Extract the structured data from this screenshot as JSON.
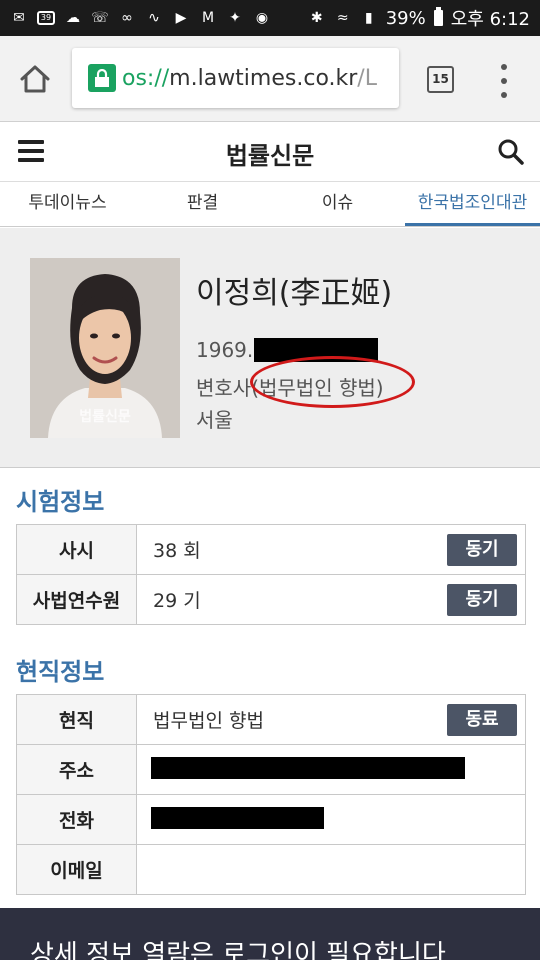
{
  "status_bar": {
    "battery_percent": "39%",
    "time": "오후 6:12",
    "left_icons": [
      "message-icon",
      "calendar-icon",
      "cloud-icon",
      "phone-icon",
      "link-icon",
      "vibrate-icon",
      "play-icon",
      "mail-icon",
      "twitter-icon",
      "instagram-icon"
    ],
    "right_icons": [
      "bluetooth-icon",
      "wifi-icon",
      "signal-icon",
      "battery-icon"
    ]
  },
  "browser": {
    "url_scheme": "os://",
    "url_host": "m.lawtimes.co.kr",
    "url_rest": "/L",
    "tab_count": "15"
  },
  "site": {
    "title": "법률신문"
  },
  "nav_tabs": [
    "투데이뉴스",
    "판결",
    "이슈",
    "한국법조인대관"
  ],
  "nav_active_index": 3,
  "profile": {
    "name": "이정희(李正姬)",
    "birth_prefix": "1969.",
    "job": "변호사(법무법인 향법)",
    "location": "서울",
    "photo_watermark": "법률신문"
  },
  "exam_section": {
    "title": "시험정보",
    "rows": [
      {
        "label": "사시",
        "value": "38 회",
        "button": "동기"
      },
      {
        "label": "사법연수원",
        "value": "29 기",
        "button": "동기"
      }
    ]
  },
  "job_section": {
    "title": "현직정보",
    "rows": [
      {
        "label": "현직",
        "value": "법무법인 향법",
        "button": "동료"
      },
      {
        "label": "주소",
        "value": ""
      },
      {
        "label": "전화",
        "value": ""
      },
      {
        "label": "이메일",
        "value": ""
      }
    ]
  },
  "login_banner": "상세 정보 열람은 로그인이 필요합니다",
  "colors": {
    "accent": "#3b73a8",
    "status_bar": "#1b1b1b",
    "button": "#4c5566",
    "banner": "#2e3040",
    "annotation": "#d11a1a"
  }
}
